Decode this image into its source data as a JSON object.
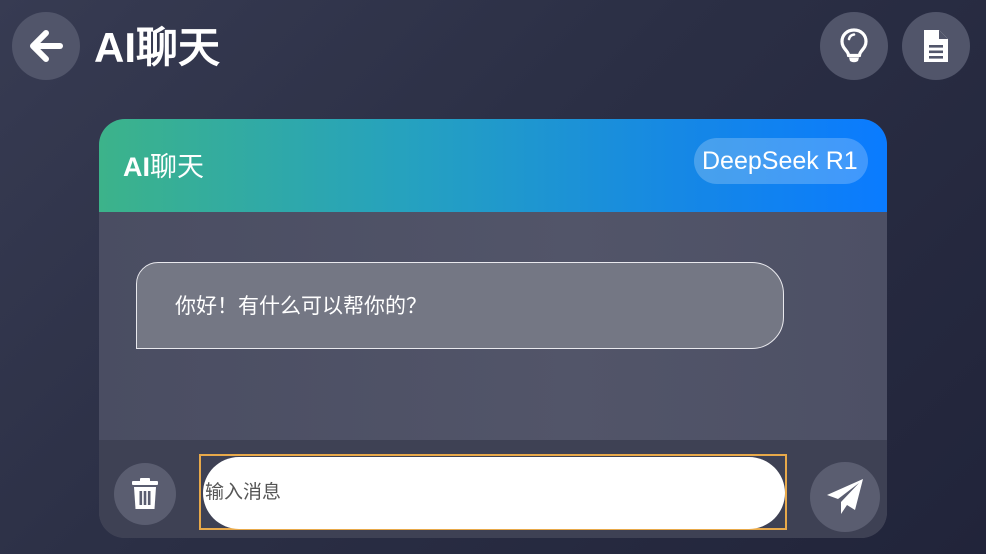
{
  "header": {
    "title": "AI聊天",
    "back_icon": "arrow-left-icon",
    "hint_icon": "lightbulb-icon",
    "document_icon": "document-icon"
  },
  "card": {
    "title_prefix": "AI",
    "title_suffix": "聊天",
    "model_badge": "DeepSeek R1",
    "gradient": [
      "#3cb38a",
      "#0a7bff"
    ]
  },
  "messages": [
    {
      "role": "assistant",
      "text": "你好！有什么可以帮你的？"
    }
  ],
  "composer": {
    "placeholder": "输入消息",
    "value": "",
    "clear_icon": "trash-icon",
    "send_icon": "paper-plane-icon",
    "focus_color": "#e8a94a"
  }
}
